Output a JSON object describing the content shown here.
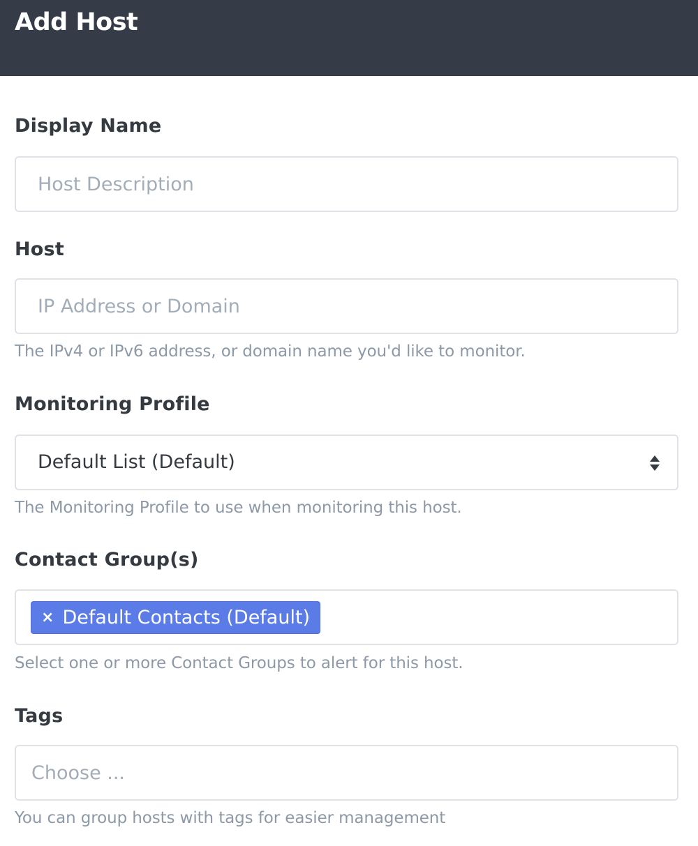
{
  "header": {
    "title": "Add Host"
  },
  "form": {
    "display_name": {
      "label": "Display Name",
      "placeholder": "Host Description",
      "value": ""
    },
    "host": {
      "label": "Host",
      "placeholder": "IP Address or Domain",
      "value": "",
      "help": "The IPv4 or IPv6 address, or domain name you'd like to monitor."
    },
    "monitoring_profile": {
      "label": "Monitoring Profile",
      "selected": "Default List (Default)",
      "help": "The Monitoring Profile to use when monitoring this host.",
      "icon": "sort-arrows-icon"
    },
    "contact_groups": {
      "label": "Contact Group(s)",
      "chips": [
        {
          "label": "Default Contacts (Default)",
          "remove_symbol": "×"
        }
      ],
      "help": "Select one or more Contact Groups to alert for this host."
    },
    "tags": {
      "label": "Tags",
      "placeholder": "Choose ...",
      "help": "You can group hosts with tags for easier management"
    }
  },
  "colors": {
    "header_bg": "#353b47",
    "chip_bg": "#5b7be6",
    "label_text": "#343a40",
    "help_text": "#8d99a6",
    "placeholder_text": "#a2adb8",
    "border": "#dfe3e8"
  }
}
